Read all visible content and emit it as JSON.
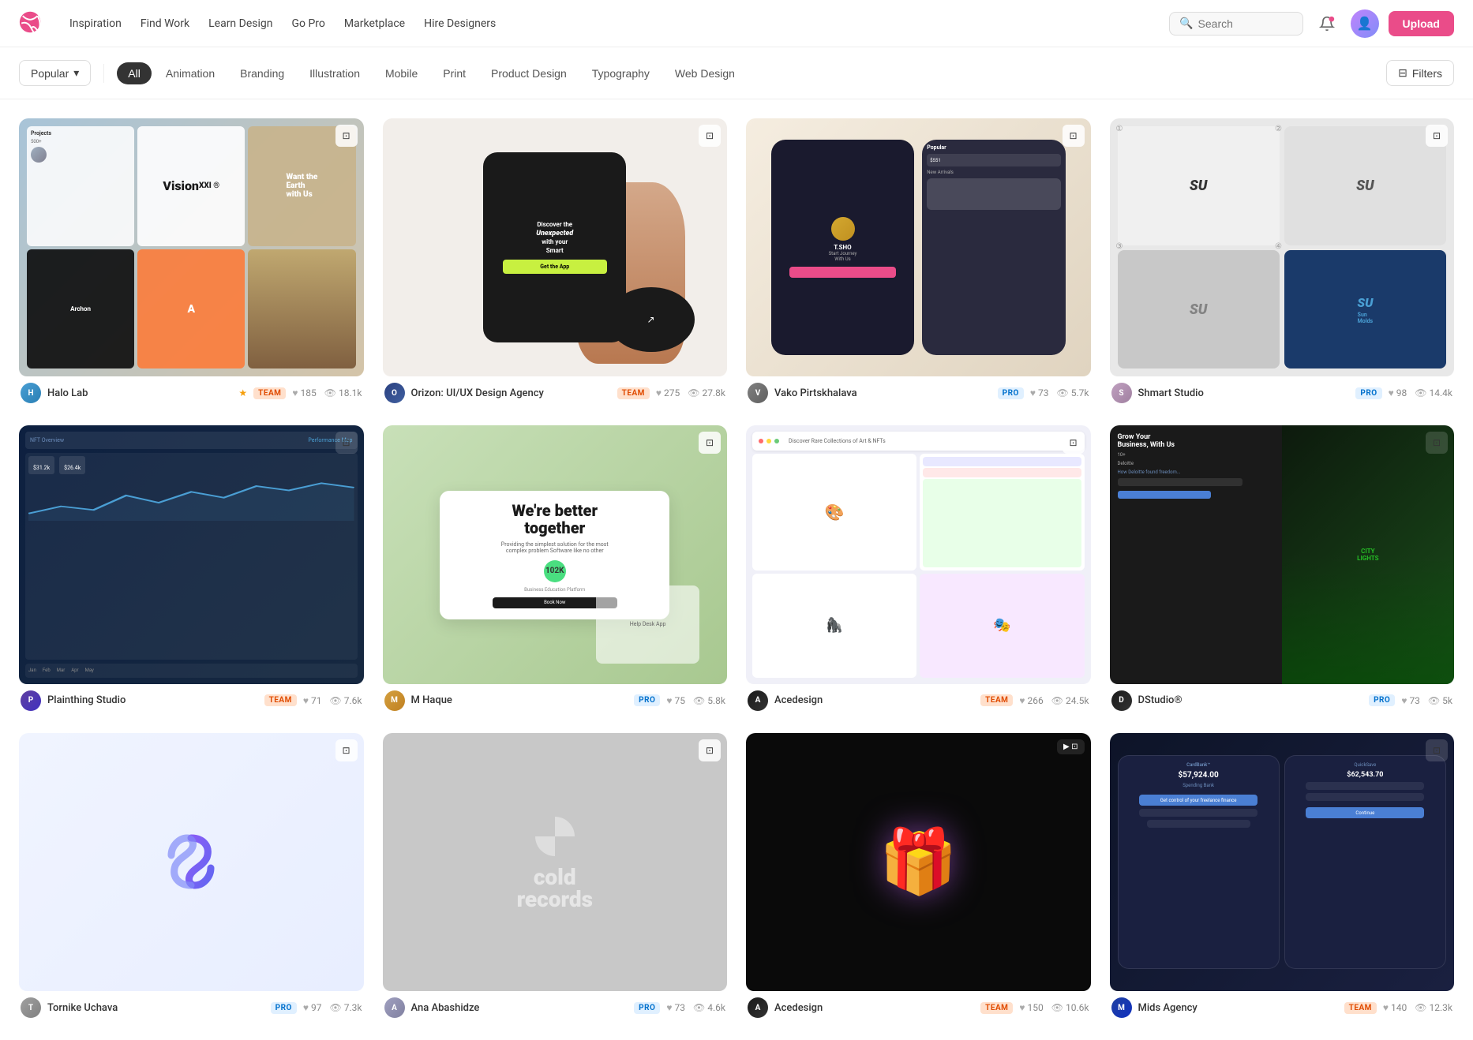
{
  "brand": {
    "name": "Dribbble",
    "logo_color": "#ea4c89"
  },
  "navbar": {
    "links": [
      {
        "id": "inspiration",
        "label": "Inspiration"
      },
      {
        "id": "find-work",
        "label": "Find Work"
      },
      {
        "id": "learn-design",
        "label": "Learn Design"
      },
      {
        "id": "go-pro",
        "label": "Go Pro"
      },
      {
        "id": "marketplace",
        "label": "Marketplace"
      },
      {
        "id": "hire-designers",
        "label": "Hire Designers"
      }
    ],
    "search_placeholder": "Search",
    "upload_label": "Upload"
  },
  "filters": {
    "sort_label": "Popular",
    "categories": [
      {
        "id": "all",
        "label": "All",
        "active": true
      },
      {
        "id": "animation",
        "label": "Animation",
        "active": false
      },
      {
        "id": "branding",
        "label": "Branding",
        "active": false
      },
      {
        "id": "illustration",
        "label": "Illustration",
        "active": false
      },
      {
        "id": "mobile",
        "label": "Mobile",
        "active": false
      },
      {
        "id": "print",
        "label": "Print",
        "active": false
      },
      {
        "id": "product-design",
        "label": "Product Design",
        "active": false
      },
      {
        "id": "typography",
        "label": "Typography",
        "active": false
      },
      {
        "id": "web-design",
        "label": "Web Design",
        "active": false
      }
    ],
    "filters_label": "Filters"
  },
  "shots": [
    {
      "id": 1,
      "author": "Halo Lab",
      "author_badge": "TEAM",
      "author_badge_type": "team",
      "has_star": true,
      "likes": "185",
      "views": "18.1k",
      "thumb_class": "thumb-halo"
    },
    {
      "id": 2,
      "author": "Orizon: UI/UX Design Agency",
      "author_badge": "TEAM",
      "author_badge_type": "team",
      "has_star": false,
      "likes": "275",
      "views": "27.8k",
      "thumb_class": "thumb-orizon"
    },
    {
      "id": 3,
      "author": "Vako Pirtskhalava",
      "author_badge": "PRO",
      "author_badge_type": "pro",
      "has_star": false,
      "likes": "73",
      "views": "5.7k",
      "thumb_class": "thumb-vako"
    },
    {
      "id": 4,
      "author": "Shmart Studio",
      "author_badge": "PRO",
      "author_badge_type": "pro",
      "has_star": false,
      "likes": "98",
      "views": "14.4k",
      "thumb_class": "thumb-shmart"
    },
    {
      "id": 5,
      "author": "Plainthing Studio",
      "author_badge": "TEAM",
      "author_badge_type": "team",
      "has_star": false,
      "likes": "71",
      "views": "7.6k",
      "thumb_class": "thumb-nft"
    },
    {
      "id": 6,
      "author": "M Haque",
      "author_badge": "PRO",
      "author_badge_type": "pro",
      "has_star": false,
      "likes": "75",
      "views": "5.8k",
      "thumb_class": "thumb-mhaque"
    },
    {
      "id": 7,
      "author": "Acedesign",
      "author_badge": "TEAM",
      "author_badge_type": "team",
      "has_star": false,
      "likes": "266",
      "views": "24.5k",
      "thumb_class": "thumb-acedesign"
    },
    {
      "id": 8,
      "author": "DStudio®",
      "author_badge": "PRO",
      "author_badge_type": "pro",
      "has_star": false,
      "likes": "73",
      "views": "5k",
      "thumb_class": "thumb-dstudio"
    },
    {
      "id": 9,
      "author": "Tornike Uchava",
      "author_badge": "PRO",
      "author_badge_type": "pro",
      "has_star": false,
      "likes": "97",
      "views": "7.3k",
      "thumb_class": "thumb-tornike"
    },
    {
      "id": 10,
      "author": "Ana Abashidze",
      "author_badge": "PRO",
      "author_badge_type": "pro",
      "has_star": false,
      "likes": "73",
      "views": "4.6k",
      "thumb_class": "thumb-ana"
    },
    {
      "id": 11,
      "author": "Acedesign",
      "author_badge": "TEAM",
      "author_badge_type": "team",
      "has_star": false,
      "likes": "150",
      "views": "10.6k",
      "thumb_class": "thumb-ace2"
    },
    {
      "id": 12,
      "author": "Mids Agency",
      "author_badge": "TEAM",
      "author_badge_type": "team",
      "has_star": false,
      "likes": "140",
      "views": "12.3k",
      "thumb_class": "thumb-mids"
    }
  ],
  "icons": {
    "search": "🔍",
    "heart": "♥",
    "eye": "👁",
    "chevron_down": "▾",
    "filter": "⊟",
    "notification": "🔔",
    "upload_cloud": "↑"
  }
}
